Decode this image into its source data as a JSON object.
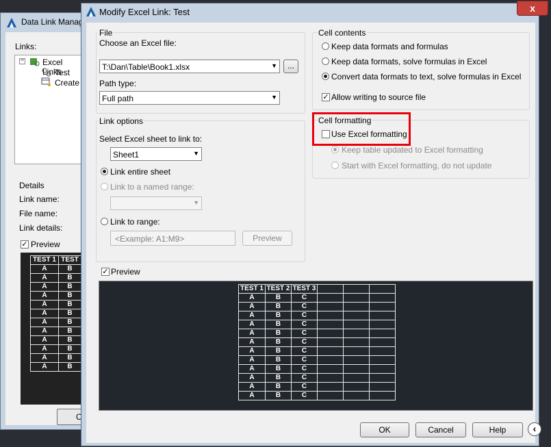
{
  "background_dialog": {
    "title": "Data Link Manag",
    "links_label": "Links:",
    "tree": [
      {
        "label": "Excel Links"
      },
      {
        "label": "Test"
      },
      {
        "label": "Create"
      }
    ],
    "details_label": "Details",
    "link_name_label": "Link name:",
    "file_name_label": "File name:",
    "link_details_label": "Link details:",
    "preview_label": "Preview",
    "preview_headers": [
      "TEST 1",
      "TEST"
    ],
    "button_label": "O"
  },
  "dialog": {
    "title": "Modify Excel Link: Test",
    "close_label": "x",
    "file_group": {
      "label": "File",
      "choose_label": "Choose an Excel file:",
      "file_value": "T:\\Dan\\Table\\Book1.xlsx",
      "browse_label": "...",
      "path_type_label": "Path type:",
      "path_type_value": "Full path"
    },
    "cell_contents": {
      "label": "Cell contents",
      "options": [
        {
          "label": "Keep data formats and formulas",
          "selected": false
        },
        {
          "label": "Keep data formats, solve formulas in Excel",
          "selected": false
        },
        {
          "label": "Convert data formats to text, solve formulas in Excel",
          "selected": true
        }
      ],
      "allow_writing_label": "Allow writing to source file",
      "allow_writing_checked": true
    },
    "cell_formatting": {
      "label": "Cell formatting",
      "use_excel_label": "Use Excel formatting",
      "use_excel_checked": false,
      "options": [
        {
          "label": "Keep table updated to Excel formatting",
          "selected": true
        },
        {
          "label": "Start with Excel formatting, do not update",
          "selected": false
        }
      ]
    },
    "link_options": {
      "label": "Link options",
      "select_sheet_label": "Select Excel sheet to link to:",
      "sheet_value": "Sheet1",
      "link_entire_label": "Link entire sheet",
      "link_named_label": "Link to a named range:",
      "link_range_label": "Link to range:",
      "range_placeholder": "<Example: A1:M9>",
      "preview_button": "Preview"
    },
    "preview": {
      "label": "Preview",
      "checked": true,
      "headers": [
        "TEST 1",
        "TEST 2",
        "TEST 3",
        "",
        "",
        ""
      ],
      "row_values": [
        "A",
        "B",
        "C"
      ],
      "row_count": 12
    },
    "buttons": {
      "ok": "OK",
      "cancel": "Cancel",
      "help": "Help"
    },
    "highlight_color": "#e8000a"
  }
}
